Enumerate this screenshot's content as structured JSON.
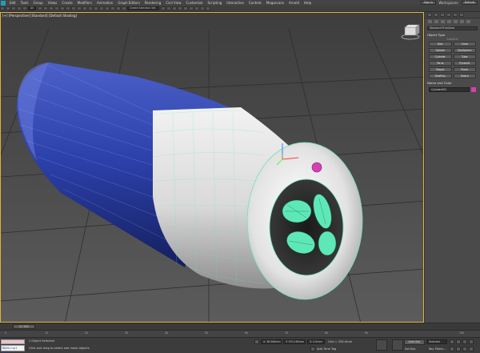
{
  "menubar": {
    "items": [
      "Edit",
      "Tools",
      "Group",
      "Views",
      "Create",
      "Modifiers",
      "Animation",
      "Graph Editors",
      "Rendering",
      "Civil View",
      "Customize",
      "Scripting",
      "Interactive",
      "Content",
      "Megascans",
      "Arnold",
      "Help"
    ],
    "sign_in": "Sign In",
    "workspaces_label": "Workspaces:",
    "workspace_value": "Default"
  },
  "toolbar": {
    "filter": "All",
    "selection_set": "Create Selection Set"
  },
  "viewport": {
    "label": "[+] [Perspective] [Standard] [Default Shading]"
  },
  "command_panel": {
    "category_dropdown": "Standard Primitives",
    "object_type_header": "Object Type",
    "autogrid": "AutoGrid",
    "buttons": [
      "Box",
      "Cone",
      "Sphere",
      "GeoSphere",
      "Cylinder",
      "Tube",
      "Torus",
      "Pyramid",
      "Teapot",
      "Plane",
      "TextPlus",
      "Hedra"
    ],
    "name_color_header": "Name and Color",
    "object_name": "Cylinder002",
    "object_color": "#d43fb4"
  },
  "timeslider": {
    "position": "0 / 100"
  },
  "trackbar": {
    "ticks": [
      "0",
      "10",
      "20",
      "30",
      "40",
      "50",
      "60",
      "70",
      "80",
      "90",
      "100"
    ]
  },
  "statusbar": {
    "maxscript": "MAXScript Mini",
    "selected": "1 Object Selected",
    "prompt": "Click and drag to select and move objects",
    "x": "X: 38.560mm",
    "y": "Y: 570.183mm",
    "z": "Z: 0.0mm",
    "grid": "Grid = 254.0mm",
    "add_time_tag": "Add Time Tag",
    "auto_key": "Auto Key",
    "set_key": "Set Key",
    "selected_mode": "Selected",
    "key_filters": "Key Filters..."
  },
  "colors": {
    "viewport_bg": "#505050",
    "tube_blue": "#2b3fa8",
    "tube_white": "#e8e8e8",
    "wire_green": "#5ee8b8",
    "accent_magenta": "#d43fb4"
  }
}
